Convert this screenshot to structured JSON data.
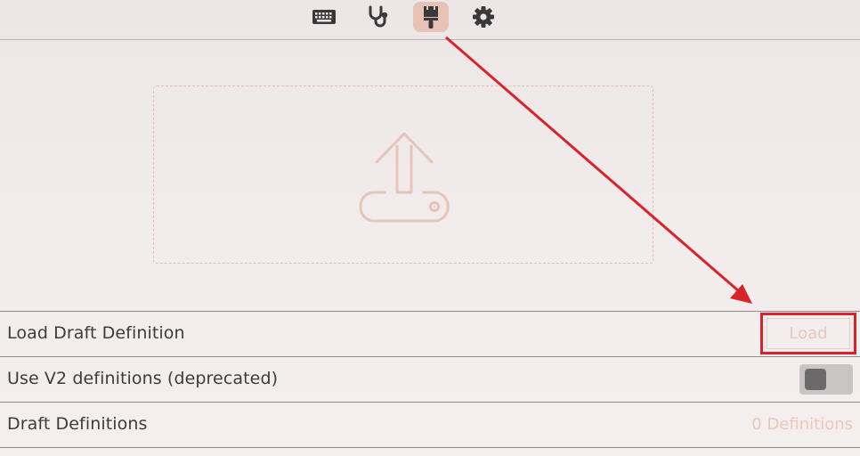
{
  "toolbar": {
    "items": [
      {
        "icon": "keyboard-icon",
        "active": false
      },
      {
        "icon": "stethoscope-icon",
        "active": false
      },
      {
        "icon": "paintbrush-icon",
        "active": true
      },
      {
        "icon": "gear-icon",
        "active": false
      }
    ]
  },
  "dropzone": {
    "icon": "upload-icon"
  },
  "rows": {
    "load_draft": {
      "label": "Load Draft Definition",
      "button_label": "Load"
    },
    "use_v2": {
      "label": "Use V2 definitions (deprecated)",
      "toggle_on": false
    },
    "draft_definitions": {
      "label": "Draft Definitions",
      "count_text": "0 Definitions"
    }
  },
  "colors": {
    "accent": "#e6c3b5",
    "highlight": "#d9232b",
    "muted_text": "#ecc7ba"
  }
}
